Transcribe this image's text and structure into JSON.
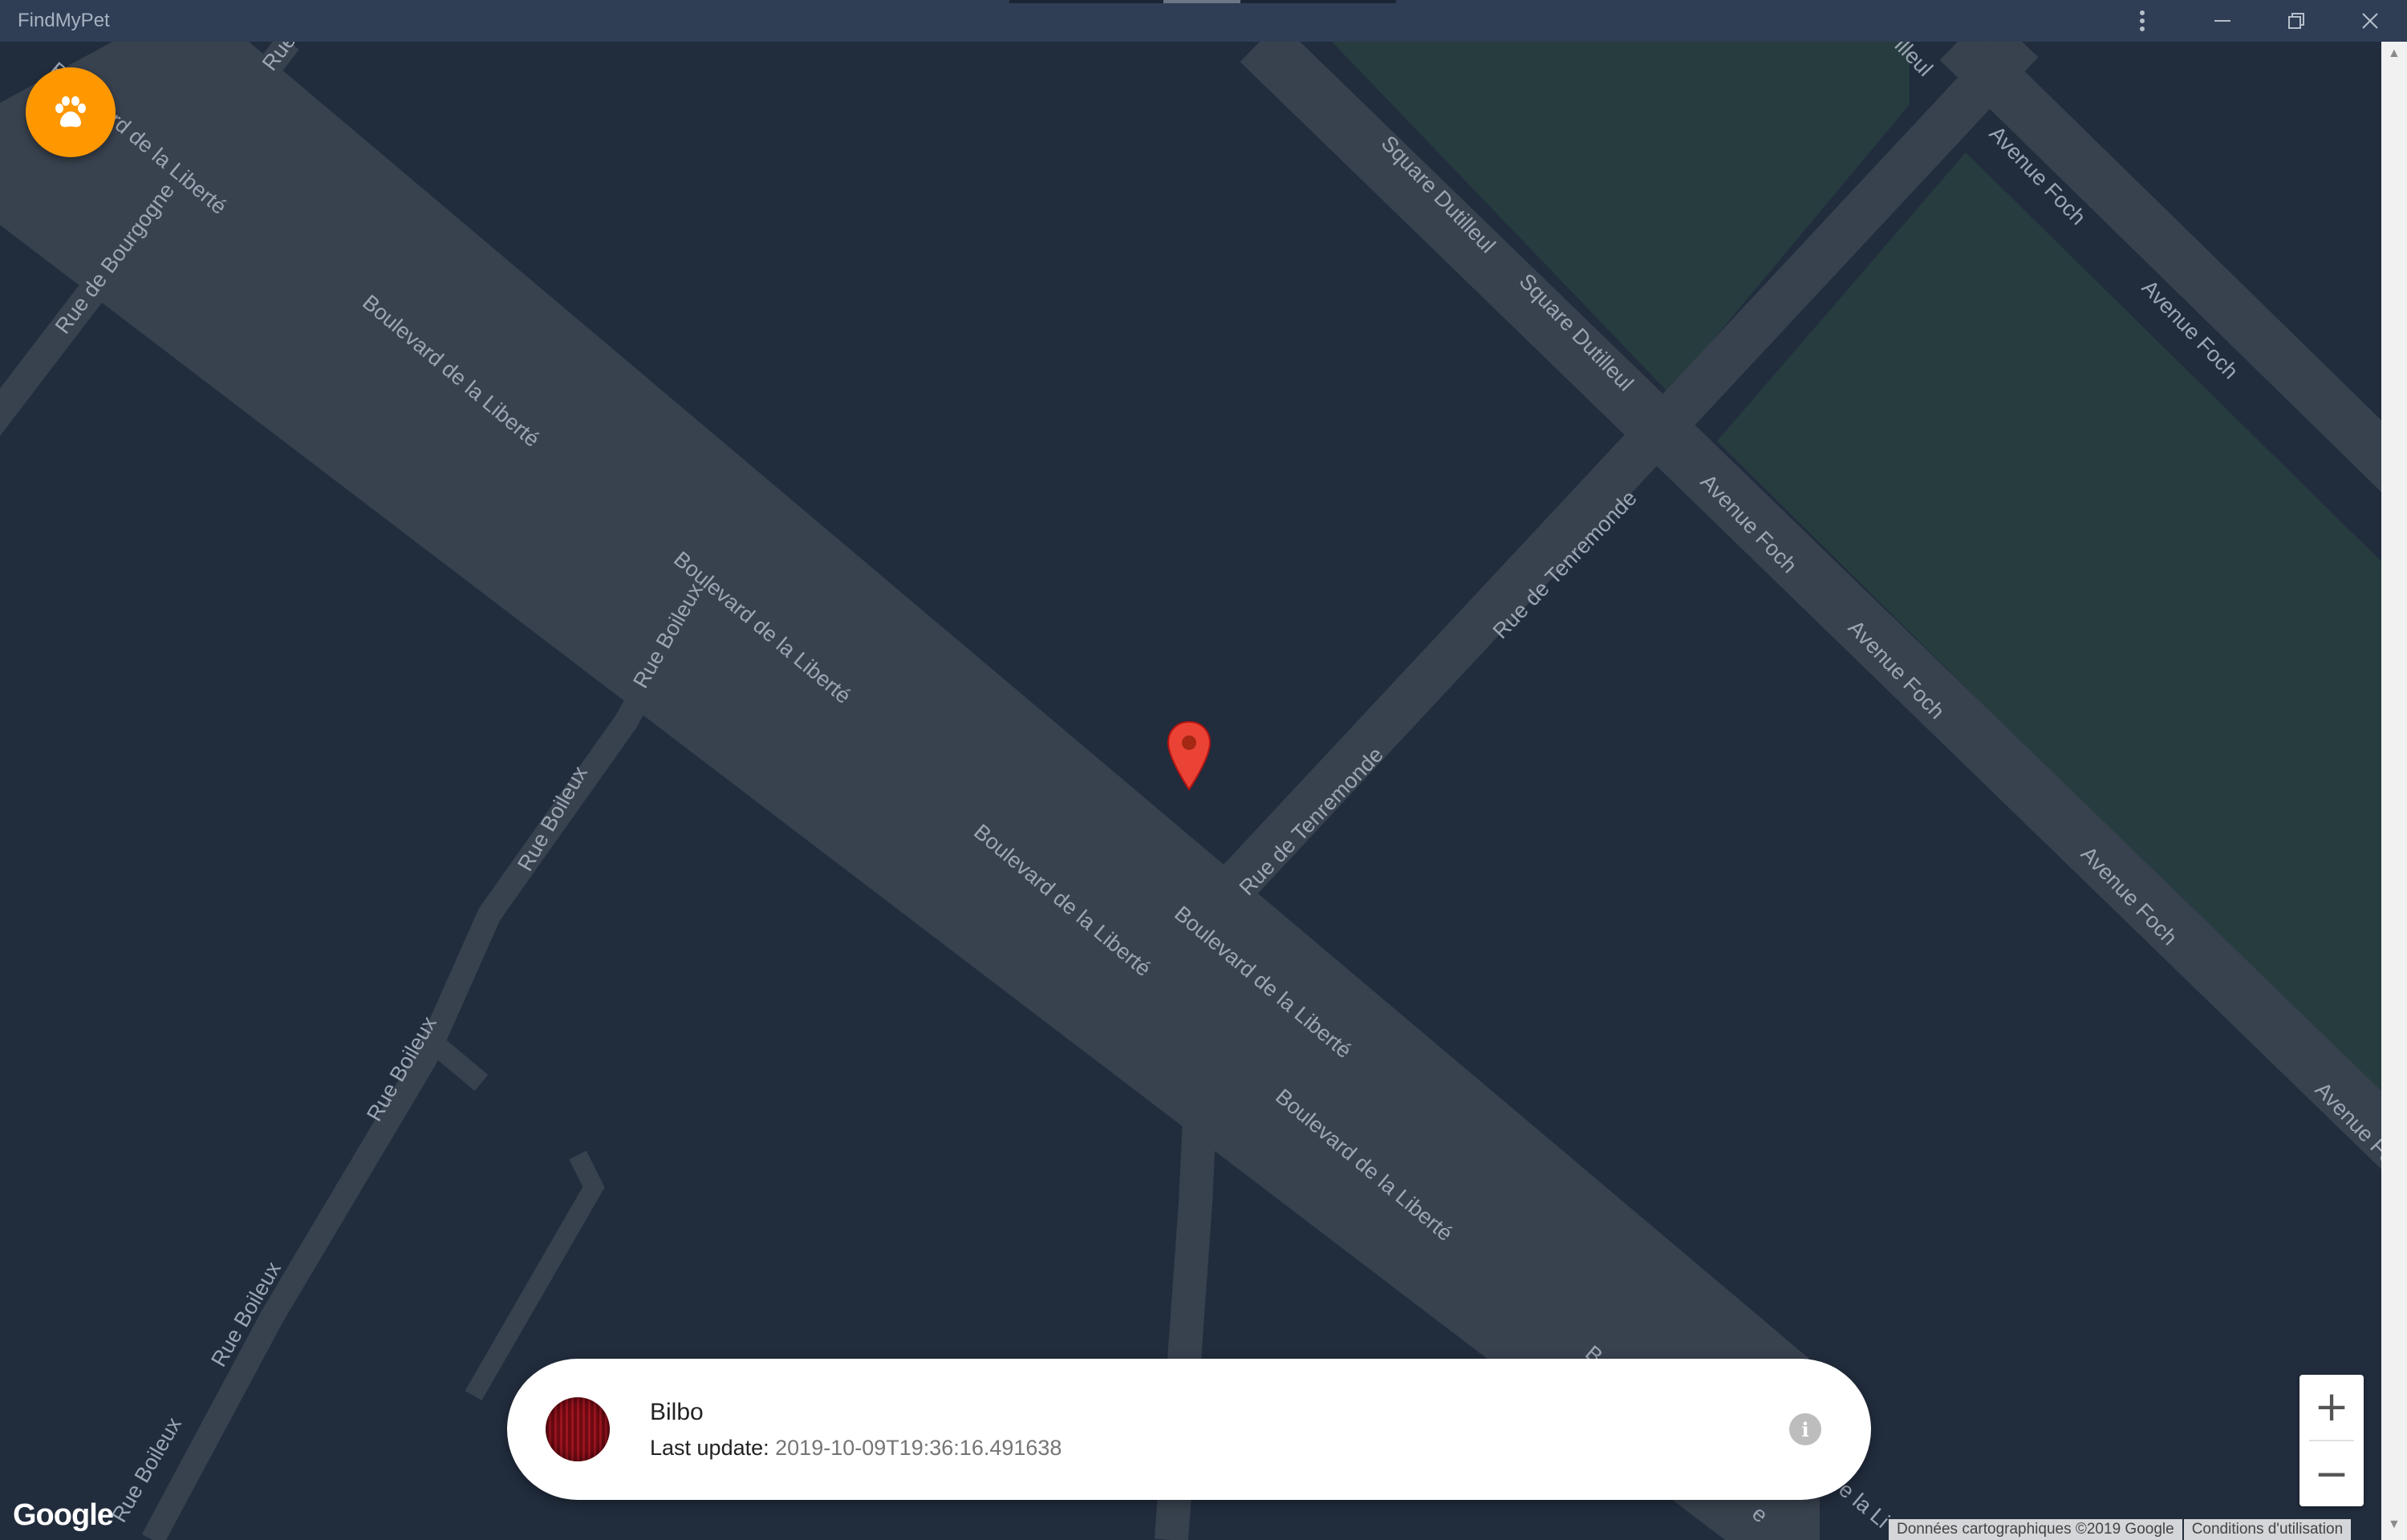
{
  "window": {
    "title": "FindMyPet",
    "menu_icon": "more-vert-icon",
    "minimize_icon": "minimize-icon",
    "restore_icon": "restore-icon",
    "close_icon": "close-icon"
  },
  "colors": {
    "map_background": "#212c3d",
    "road": "#38414e",
    "park": "#263c3f",
    "label_text": "#9ca5b3",
    "titlebar": "#2f3e55",
    "fab": "#ff9800",
    "marker": "#ea4335",
    "marker_dot": "#a52714"
  },
  "map": {
    "streets": [
      {
        "name": "Boulevard de la Liberté"
      },
      {
        "name": "Rue de Bourgogne"
      },
      {
        "name": "Rue Boileux"
      },
      {
        "name": "Rue de Tenremonde"
      },
      {
        "name": "Square Dutilleul"
      },
      {
        "name": "Avenue Foch"
      }
    ],
    "partial_labels": [
      "Rue",
      "illeul",
      "B",
      "e la Li",
      "e"
    ],
    "marker_icon": "map-pin-icon"
  },
  "fab": {
    "icon": "paw-icon"
  },
  "pet_card": {
    "name": "Bilbo",
    "last_update_label": "Last update:",
    "last_update_value": "2019-10-09T19:36:16.491638",
    "info_icon": "info-icon",
    "avatar_icon": "pet-avatar"
  },
  "zoom": {
    "zoom_in_label": "+",
    "zoom_out_label": "−"
  },
  "footer": {
    "logo": "Google",
    "map_data": "Données cartographiques ©2019 Google",
    "terms": "Conditions d'utilisation"
  }
}
